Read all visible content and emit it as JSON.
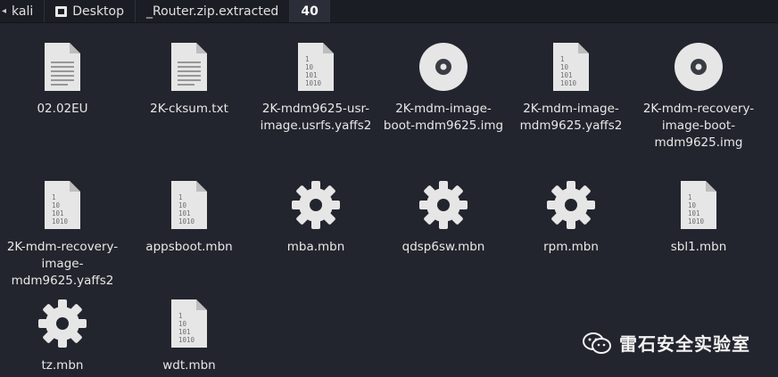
{
  "breadcrumb": [
    {
      "label": "kali",
      "icon": "chevron-left-icon"
    },
    {
      "label": "Desktop",
      "icon": "folder-icon"
    },
    {
      "label": "_Router.zip.extracted"
    },
    {
      "label": "40",
      "active": true
    }
  ],
  "files": [
    {
      "name": "02.02EU",
      "icon": "text-file-icon"
    },
    {
      "name": "2K-cksum.txt",
      "icon": "text-file-icon"
    },
    {
      "name": "2K-mdm9625-usr-image.usrfs.yaffs2",
      "icon": "binary-file-icon"
    },
    {
      "name": "2K-mdm-image-boot-mdm9625.img",
      "icon": "disc-image-icon"
    },
    {
      "name": "2K-mdm-image-mdm9625.yaffs2",
      "icon": "binary-file-icon"
    },
    {
      "name": "2K-mdm-recovery-image-boot-mdm9625.img",
      "icon": "disc-image-icon"
    },
    {
      "name": "2K-mdm-recovery-image-mdm9625.yaffs2",
      "icon": "binary-file-icon"
    },
    {
      "name": "appsboot.mbn",
      "icon": "binary-file-icon"
    },
    {
      "name": "mba.mbn",
      "icon": "gear-file-icon"
    },
    {
      "name": "qdsp6sw.mbn",
      "icon": "gear-file-icon"
    },
    {
      "name": "rpm.mbn",
      "icon": "gear-file-icon"
    },
    {
      "name": "sbl1.mbn",
      "icon": "binary-file-icon"
    },
    {
      "name": "tz.mbn",
      "icon": "gear-file-icon"
    },
    {
      "name": "wdt.mbn",
      "icon": "binary-file-icon"
    }
  ],
  "watermark": {
    "text": "雷石安全实验室",
    "icon": "wechat-icon"
  },
  "colors": {
    "background": "#23252e",
    "pathbar": "#1b1d24",
    "icon": "#e6e6e6"
  }
}
